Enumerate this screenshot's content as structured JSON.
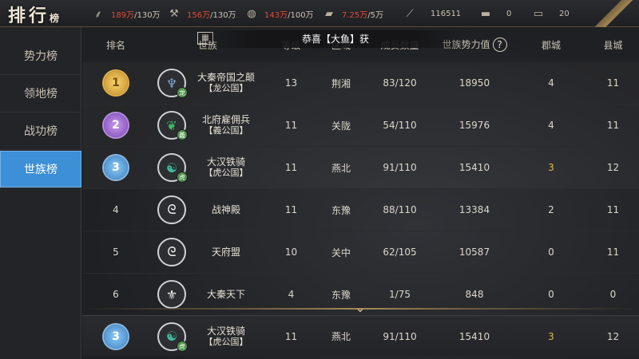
{
  "title": {
    "main": "排行",
    "small": "榜"
  },
  "resources": [
    {
      "icon": "wheat-icon",
      "current": "189万",
      "max": "/130万"
    },
    {
      "icon": "wood-icon",
      "current": "156万",
      "max": "/130万"
    },
    {
      "icon": "stone-icon",
      "current": "143万",
      "max": "/100万"
    },
    {
      "icon": "iron-icon",
      "current": "7.25万",
      "max": "/5万"
    },
    {
      "icon": "copper-icon",
      "value": "116511"
    },
    {
      "icon": "gold-icon",
      "value": "0"
    },
    {
      "icon": "silver-icon",
      "value": "20"
    }
  ],
  "tabs": [
    {
      "label": "势力榜",
      "active": false
    },
    {
      "label": "领地榜",
      "active": false
    },
    {
      "label": "战功榜",
      "active": false
    },
    {
      "label": "世族榜",
      "active": true
    }
  ],
  "headers": {
    "rank": "排名",
    "clan": "世族",
    "level": "等级",
    "region": "区域",
    "members": "成员数量",
    "power": "世族势力值",
    "help": "?",
    "prefecture": "郡城",
    "county": "县城"
  },
  "banner": {
    "text": "恭喜【大鱼】获",
    "icon": "▦"
  },
  "rows": [
    {
      "rank": "1",
      "medal": "gold",
      "emblem": "dragon",
      "emblemTag": "龙",
      "name": "大秦帝国之颠",
      "sub": "【龙公国】",
      "level": "13",
      "region": "荆湘",
      "members": "83/120",
      "power": "18950",
      "prefecture": "4",
      "county": "11"
    },
    {
      "rank": "2",
      "medal": "purple",
      "emblem": "green",
      "emblemTag": "義",
      "name": "北府雇佣兵",
      "sub": "【義公国】",
      "level": "11",
      "region": "关陇",
      "members": "54/110",
      "power": "15976",
      "prefecture": "4",
      "county": "11"
    },
    {
      "rank": "3",
      "medal": "blue",
      "emblem": "tiger",
      "emblemTag": "虎",
      "name": "大汉铁骑",
      "sub": "【虎公国】",
      "level": "11",
      "region": "燕北",
      "members": "91/110",
      "power": "15410",
      "prefecture": "3",
      "county": "12"
    },
    {
      "rank": "4",
      "medal": "",
      "emblem": "plain",
      "emblemTag": "",
      "name": "战神殿",
      "sub": "",
      "level": "11",
      "region": "东豫",
      "members": "88/110",
      "power": "13384",
      "prefecture": "2",
      "county": "11"
    },
    {
      "rank": "5",
      "medal": "",
      "emblem": "plain",
      "emblemTag": "",
      "name": "天府盟",
      "sub": "",
      "level": "10",
      "region": "关中",
      "members": "62/105",
      "power": "10587",
      "prefecture": "0",
      "county": "11"
    },
    {
      "rank": "6",
      "medal": "",
      "emblem": "leaf",
      "emblemTag": "",
      "name": "大秦天下",
      "sub": "",
      "level": "4",
      "region": "东豫",
      "members": "1/75",
      "power": "848",
      "prefecture": "0",
      "county": "0"
    }
  ],
  "pinned": {
    "rank": "3",
    "name": "大汉铁骑",
    "sub": "【虎公国】",
    "emblemTag": "虎",
    "level": "11",
    "region": "燕北",
    "members": "91/110",
    "power": "15410",
    "prefecture": "3",
    "county": "12"
  },
  "colors": {
    "accent": "#3d8fd6",
    "gold": "#e8b74a",
    "resourceRed": "#e04a3a"
  }
}
